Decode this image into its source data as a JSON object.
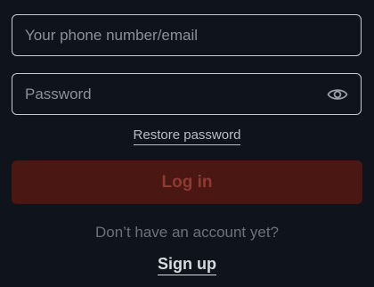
{
  "form": {
    "phone_placeholder": "Your phone number/email",
    "phone_value": "",
    "password_placeholder": "Password",
    "password_value": "",
    "password_toggle_icon": "eye-icon",
    "restore_label": "Restore password",
    "login_label": "Log in",
    "no_account_text": "Don’t have an account yet?",
    "signup_label": "Sign up"
  },
  "colors": {
    "background": "#0f141c",
    "border": "#c7ccd4",
    "login_bg": "#4a1712",
    "login_text": "#8b3a34"
  }
}
